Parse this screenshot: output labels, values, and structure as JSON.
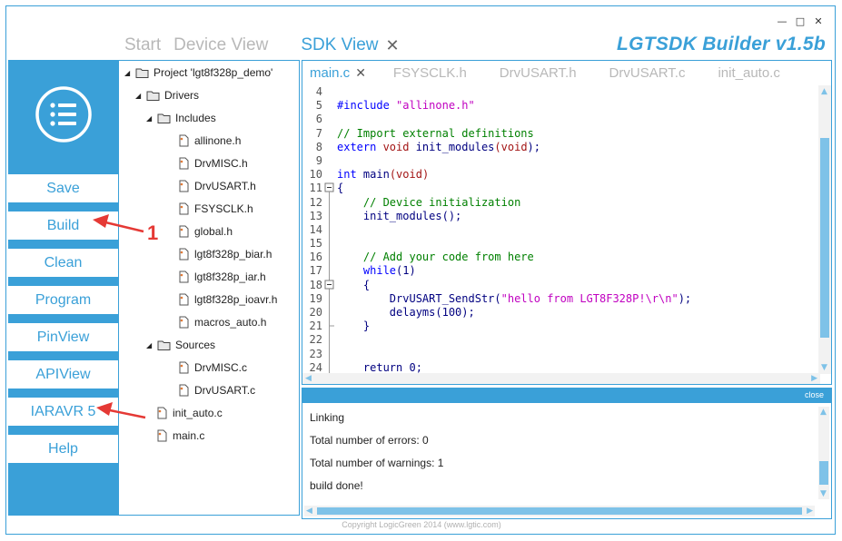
{
  "window": {
    "minimize": "—",
    "maximize": "□",
    "close": "✕"
  },
  "topnav": {
    "items": [
      "Start",
      "Device View"
    ],
    "active": "SDK View",
    "active_close": "✕"
  },
  "brand": "LGTSDK Builder v1.5b",
  "sidebar": {
    "buttons": [
      "Save",
      "Build",
      "Clean",
      "Program",
      "PinView",
      "APIView",
      "IARAVR 5",
      "Help"
    ]
  },
  "tree": {
    "project": "Project 'lgt8f328p_demo'",
    "drivers": "Drivers",
    "includes": "Includes",
    "include_files": [
      "allinone.h",
      "DrvMISC.h",
      "DrvUSART.h",
      "FSYSCLK.h",
      "global.h",
      "lgt8f328p_biar.h",
      "lgt8f328p_iar.h",
      "lgt8f328p_ioavr.h",
      "macros_auto.h"
    ],
    "sources": "Sources",
    "source_files": [
      "DrvMISC.c",
      "DrvUSART.c"
    ],
    "root_files": [
      "init_auto.c",
      "main.c"
    ]
  },
  "editor": {
    "tabs": {
      "active": "main.c",
      "close": "✕",
      "others": [
        "FSYSCLK.h",
        "DrvUSART.h",
        "DrvUSART.c",
        "init_auto.c"
      ]
    },
    "line_numbers": [
      "4",
      "5",
      "6",
      "7",
      "8",
      "9",
      "10",
      "11",
      "12",
      "13",
      "14",
      "15",
      "16",
      "17",
      "18",
      "19",
      "20",
      "21",
      "22",
      "23",
      "24"
    ],
    "code": {
      "l5_pp": "#include ",
      "l5_str": "\"allinone.h\"",
      "l7": "// Import external definitions",
      "l8_kw1": "extern ",
      "l8_kw2": "void ",
      "l8_fn": "init_modules",
      "l8_p1": "(",
      "l8_kw3": "void",
      "l8_p2": ");",
      "l10_kw1": "int ",
      "l10_fn": "main",
      "l10_p1": "(",
      "l10_kw2": "void",
      "l10_p2": ")",
      "l11": "{",
      "l12": "    // Device initialization",
      "l13": "    init_modules();",
      "l16": "    // Add your code from here",
      "l17_kw": "    while",
      "l17_rest": "(1)",
      "l18": "    {",
      "l19_fn": "        DrvUSART_SendStr(",
      "l19_str": "\"hello from LGT8F328P!\\r\\n\"",
      "l19_end": ");",
      "l20": "        delayms(100);",
      "l21": "    }",
      "l24": "    return 0;"
    }
  },
  "output": {
    "close_label": "close",
    "lines": [
      "Linking",
      "Total number of errors: 0",
      "Total number of warnings: 1",
      "build done!"
    ]
  },
  "footer": "Copyright LogicGreen 2014 (www.lgtic.com)",
  "annotation": {
    "number": "1"
  },
  "colors": {
    "accent": "#3aa0d8",
    "arrow": "#e53935"
  }
}
